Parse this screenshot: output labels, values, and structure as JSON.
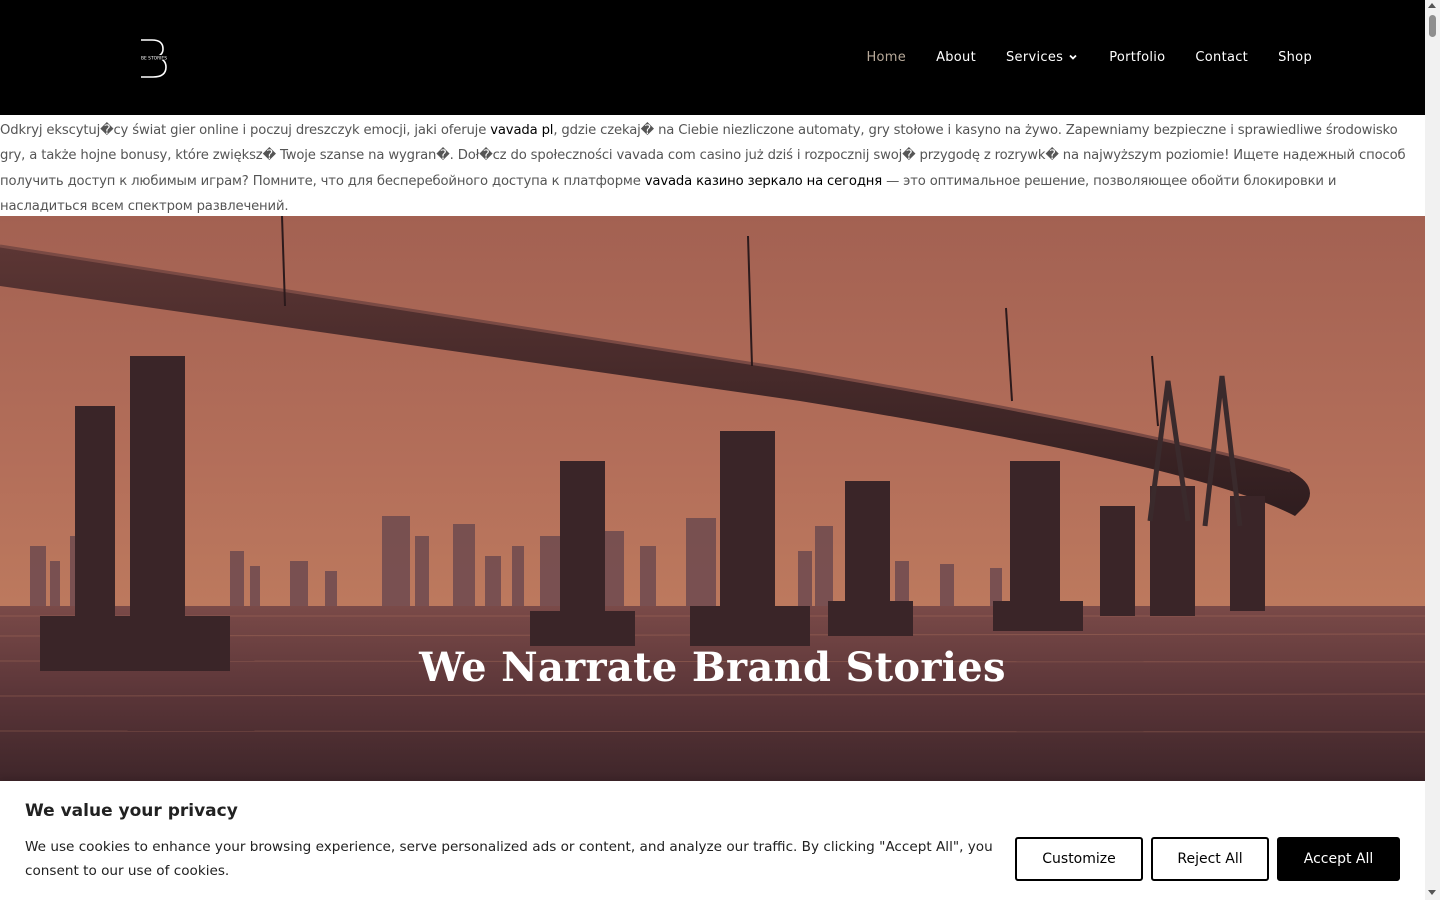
{
  "header": {
    "logo_alt": "BE STORIES",
    "nav": {
      "home": "Home",
      "about": "About",
      "services": "Services",
      "portfolio": "Portfolio",
      "contact": "Contact",
      "shop": "Shop"
    },
    "active_color": "#b7a999"
  },
  "intro": {
    "p1": "Odkryj ekscytuj�cy świat gier online i poczuj dreszczyk emocji, jaki oferuje ",
    "link1": "vavada pl",
    "p2": ", gdzie czekaj� na Ciebie niezliczone automaty, gry stołowe i kasyno na żywo. Zapewniamy bezpieczne i sprawiedliwe środowisko gry, a także hojne bonusy, które zwiększ� Twoje szanse na wygran�. Doł�cz do społeczności vavada com casino już dziś i rozpocznij swoj� przygodę z rozrywk� na najwyższym poziomie! Ищете надежный способ получить доступ к любимым играм? Помните, что для бесперебойного доступа к платформе ",
    "link2": "vavada казино зеркало на сегодня",
    "p3": " — это оптимальное решение, позволяющее обойти блокировки и насладиться всем спектром развлечений."
  },
  "hero": {
    "title": "We Narrate Brand Stories"
  },
  "cookie": {
    "title": "We value your privacy",
    "text": "We use cookies to enhance your browsing experience, serve personalized ads or content, and analyze our traffic. By clicking \"Accept All\", you consent to our use of cookies.",
    "customize": "Customize",
    "reject": "Reject All",
    "accept": "Accept All"
  }
}
